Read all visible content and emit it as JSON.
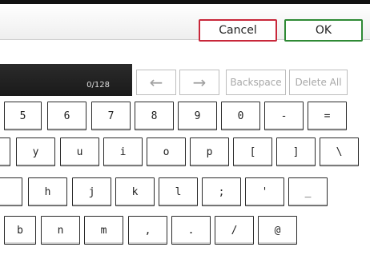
{
  "header": {
    "cancel_label": "Cancel",
    "ok_label": "OK"
  },
  "input": {
    "counter": "0/128"
  },
  "toolbar": {
    "left_arrow": "←",
    "right_arrow": "→",
    "backspace_label": "Backspace",
    "delete_all_label": "Delete All"
  },
  "keyboard": {
    "row1": [
      "5",
      "6",
      "7",
      "8",
      "9",
      "0",
      "-",
      "="
    ],
    "row2": [
      "",
      "y",
      "u",
      "i",
      "o",
      "p",
      "[",
      "]",
      "\\"
    ],
    "row3": [
      "",
      "h",
      "j",
      "k",
      "l",
      ";",
      "'",
      "_"
    ],
    "row4": [
      "b",
      "n",
      "m",
      ",",
      ".",
      "/",
      "@"
    ]
  },
  "colors": {
    "cancel_border": "#c8273a",
    "ok_border": "#2f8a35",
    "display_bg": "#1f1f1f"
  }
}
